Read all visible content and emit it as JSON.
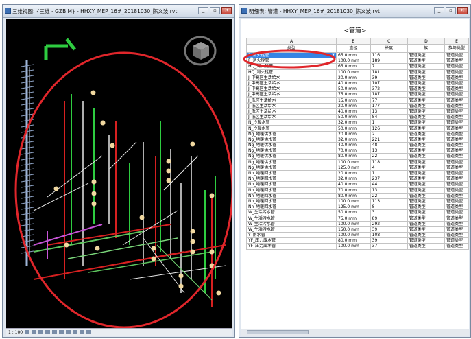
{
  "left_window": {
    "title": "三维视图: {三维 - GZBIM} - HHXY_MEP_16#_20181030_陈义波.rvt",
    "buttons": {
      "minimize": "_",
      "restore": "▫",
      "close": "✕"
    },
    "status": {
      "scale": "1 : 100"
    }
  },
  "right_window": {
    "title": "明细表: 管道 - HHXY_MEP_16#_20181030_陈义波.rvt",
    "buttons": {
      "minimize": "_",
      "restore": "▫",
      "close": "✕"
    }
  },
  "schedule": {
    "title": "<管道>",
    "column_letters": [
      "A",
      "B",
      "C",
      "D",
      "E"
    ],
    "column_headers": [
      "类型",
      "直径",
      "长度",
      "族",
      "族与类型"
    ],
    "rows": [
      [
        "F_消火栓管",
        "65.0 mm",
        "116",
        "管道类型",
        "管道类型"
      ],
      [
        "F_消火栓管",
        "100.0 mm",
        "189",
        "管道类型",
        "管道类型"
      ],
      [
        "HQ_消火栓管",
        "65.0 mm",
        "7",
        "管道类型",
        "管道类型"
      ],
      [
        "HQ_消火栓管",
        "100.0 mm",
        "181",
        "管道类型",
        "管道类型"
      ],
      [
        "J_中高区生活给水",
        "20.0 mm",
        "39",
        "管道类型",
        "管道类型"
      ],
      [
        "J_中高区生活给水",
        "40.0 mm",
        "107",
        "管道类型",
        "管道类型"
      ],
      [
        "J_中高区生活给水",
        "50.0 mm",
        "372",
        "管道类型",
        "管道类型"
      ],
      [
        "J_中高区生活给水",
        "75.0 mm",
        "187",
        "管道类型",
        "管道类型"
      ],
      [
        "J_低区生活给水",
        "15.0 mm",
        "77",
        "管道类型",
        "管道类型"
      ],
      [
        "J_低区生活给水",
        "20.0 mm",
        "177",
        "管道类型",
        "管道类型"
      ],
      [
        "J_低区生活给水",
        "40.0 mm",
        "13",
        "管道类型",
        "管道类型"
      ],
      [
        "J_低区生活给水",
        "50.0 mm",
        "84",
        "管道类型",
        "管道类型"
      ],
      [
        "N_冷凝水管",
        "32.0 mm",
        "1",
        "管道类型",
        "管道类型"
      ],
      [
        "N_冷凝水管",
        "50.0 mm",
        "126",
        "管道类型",
        "管道类型"
      ],
      [
        "Ng_地暖供水管",
        "20.0 mm",
        "2",
        "管道类型",
        "管道类型"
      ],
      [
        "Ng_地暖供水管",
        "32.0 mm",
        "221",
        "管道类型",
        "管道类型"
      ],
      [
        "Ng_地暖供水管",
        "40.0 mm",
        "48",
        "管道类型",
        "管道类型"
      ],
      [
        "Ng_地暖供水管",
        "70.0 mm",
        "13",
        "管道类型",
        "管道类型"
      ],
      [
        "Ng_地暖供水管",
        "80.0 mm",
        "22",
        "管道类型",
        "管道类型"
      ],
      [
        "Ng_地暖供水管",
        "100.0 mm",
        "118",
        "管道类型",
        "管道类型"
      ],
      [
        "Ng_地暖供水管",
        "125.0 mm",
        "4",
        "管道类型",
        "管道类型"
      ],
      [
        "Nh_地暖回水管",
        "20.0 mm",
        "1",
        "管道类型",
        "管道类型"
      ],
      [
        "Nh_地暖回水管",
        "32.0 mm",
        "237",
        "管道类型",
        "管道类型"
      ],
      [
        "Nh_地暖回水管",
        "40.0 mm",
        "44",
        "管道类型",
        "管道类型"
      ],
      [
        "Nh_地暖回水管",
        "70.0 mm",
        "13",
        "管道类型",
        "管道类型"
      ],
      [
        "Nh_地暖回水管",
        "80.0 mm",
        "22",
        "管道类型",
        "管道类型"
      ],
      [
        "Nh_地暖回水管",
        "100.0 mm",
        "113",
        "管道类型",
        "管道类型"
      ],
      [
        "Nh_地暖回水管",
        "125.0 mm",
        "8",
        "管道类型",
        "管道类型"
      ],
      [
        "W_生活污水管",
        "50.0 mm",
        "3",
        "管道类型",
        "管道类型"
      ],
      [
        "W_生活污水管",
        "75.0 mm",
        "89",
        "管道类型",
        "管道类型"
      ],
      [
        "W_生活污水管",
        "100.0 mm",
        "292",
        "管道类型",
        "管道类型"
      ],
      [
        "W_生活污水管",
        "150.0 mm",
        "39",
        "管道类型",
        "管道类型"
      ],
      [
        "Y_雨水管",
        "100.0 mm",
        "108",
        "管道类型",
        "管道类型"
      ],
      [
        "YF_压力废水管",
        "80.0 mm",
        "39",
        "管道类型",
        "管道类型"
      ],
      [
        "YF_压力废水管",
        "100.0 mm",
        "37",
        "管道类型",
        "管道类型"
      ]
    ]
  },
  "colors": {
    "annotation_red": "#e0262b",
    "selection_blue": "#3584e4",
    "pipe_green": "#2ecc40",
    "pipe_red": "#d62020",
    "pipe_white": "#e8e8e8",
    "fixture_tan": "#f0d8a0",
    "pipe_magenta": "#c855d8"
  }
}
